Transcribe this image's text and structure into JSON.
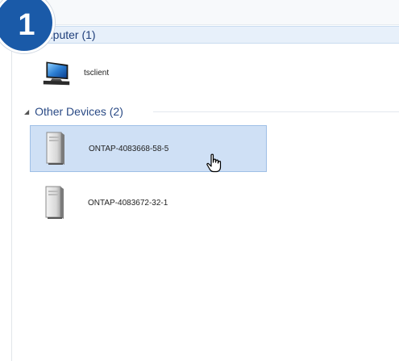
{
  "step_badge": {
    "number": "1"
  },
  "groups": {
    "computer": {
      "label": "mputer (1)",
      "items": [
        {
          "name": "tsclient",
          "icon": "monitor-icon"
        }
      ]
    },
    "other_devices": {
      "label": "Other Devices (2)",
      "expand_icon": "triangle-collapse-icon",
      "items": [
        {
          "name": "ONTAP-4083668-58-5",
          "icon": "server-tower-icon",
          "selected": true
        },
        {
          "name": "ONTAP-4083672-32-1",
          "icon": "server-tower-icon",
          "selected": false
        }
      ]
    }
  },
  "cursor": {
    "icon": "hand-pointer-icon"
  },
  "colors": {
    "badge": "#1a5aa8",
    "group_header_bg": "#e7f0fa",
    "group_header_text": "#1e3e7a",
    "selection_bg": "#cfe0f5",
    "selection_border": "#9fbfe6"
  }
}
